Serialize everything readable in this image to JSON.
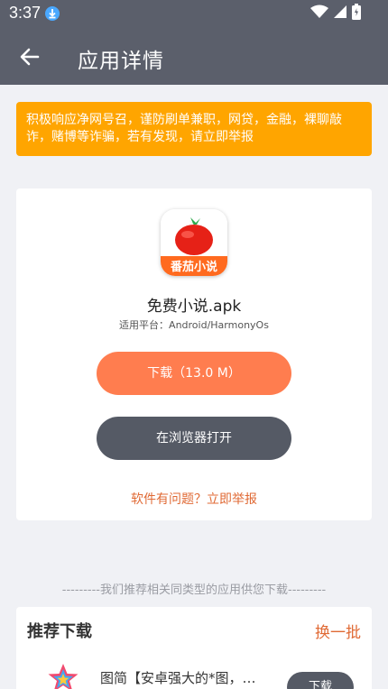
{
  "status_bar": {
    "time": "3:37"
  },
  "app_bar": {
    "title": "应用详情"
  },
  "warning": {
    "text": "积极响应净网号召，谨防刷单兼职，网贷，金融，裸聊敲诈，赌博等诈骗，若有发现，请立即举报"
  },
  "app": {
    "icon_label": "番茄小说",
    "name": "免费小说.apk",
    "platform": "适用平台：Android/HarmonyOs",
    "download_label": "下载（13.0 M）",
    "browser_label": "在浏览器打开",
    "report_label": "软件有问题？立即举报"
  },
  "recommend": {
    "note": "---------我们推荐相关同类型的应用供您下载---------",
    "title": "推荐下载",
    "refresh_label": "换一批",
    "items": [
      {
        "name": "图简【安卓强大的*图，…",
        "button_label": "下载"
      }
    ]
  },
  "colors": {
    "header": "#5b5f6b",
    "warning": "#ffa500",
    "download": "#ff7d4f",
    "browser": "#555a65",
    "link": "#e06a35"
  }
}
